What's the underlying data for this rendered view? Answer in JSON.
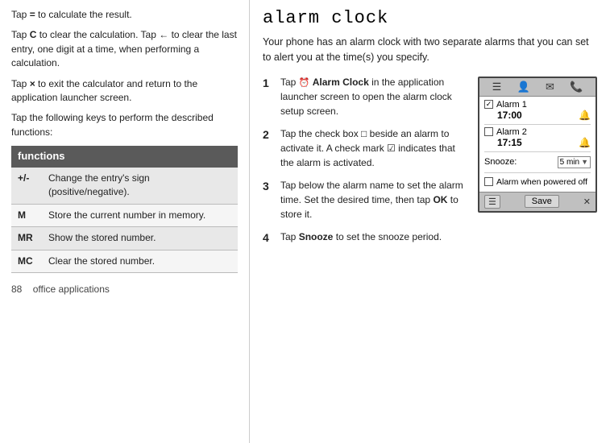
{
  "left": {
    "paragraphs": [
      "Tap = to calculate the result.",
      "Tap C to clear the calculation. Tap ← to clear the last entry, one digit at a time, when performing a calculation.",
      "Tap × to exit the calculator and return to the application launcher screen.",
      "Tap the following keys to perform the described functions:"
    ],
    "table": {
      "header": "functions",
      "rows": [
        {
          "key": "+/-",
          "description": "Change the entry's sign (positive/negative)."
        },
        {
          "key": "M",
          "description": "Store the current number in memory."
        },
        {
          "key": "MR",
          "description": "Show the stored number."
        },
        {
          "key": "MC",
          "description": "Clear the stored number."
        }
      ]
    },
    "footer": {
      "page_number": "88",
      "section": "office applications"
    }
  },
  "right": {
    "title": "alarm clock",
    "intro": "Your phone has an alarm clock with two separate alarms that you can set to alert you at the time(s) you specify.",
    "steps": [
      {
        "number": "1",
        "text": "Tap  Alarm Clock in the application launcher screen to open the alarm clock setup screen."
      },
      {
        "number": "2",
        "text": "Tap the check box □ beside an alarm to activate it. A check mark ☑ indicates that the alarm is activated."
      },
      {
        "number": "3",
        "text": "Tap below the alarm name to set the alarm time. Set the desired time, then tap OK to store it."
      },
      {
        "number": "4",
        "text": "Tap Snooze to set the snooze period."
      }
    ],
    "alarm_ui": {
      "alarm1": {
        "name": "Alarm 1",
        "time": "17:00",
        "checked": true
      },
      "alarm2": {
        "name": "Alarm 2",
        "time": "17:15",
        "checked": false
      },
      "snooze_label": "Snooze:",
      "snooze_value": "5 min",
      "powered_off_label": "Alarm when powered off",
      "save_label": "Save"
    }
  }
}
